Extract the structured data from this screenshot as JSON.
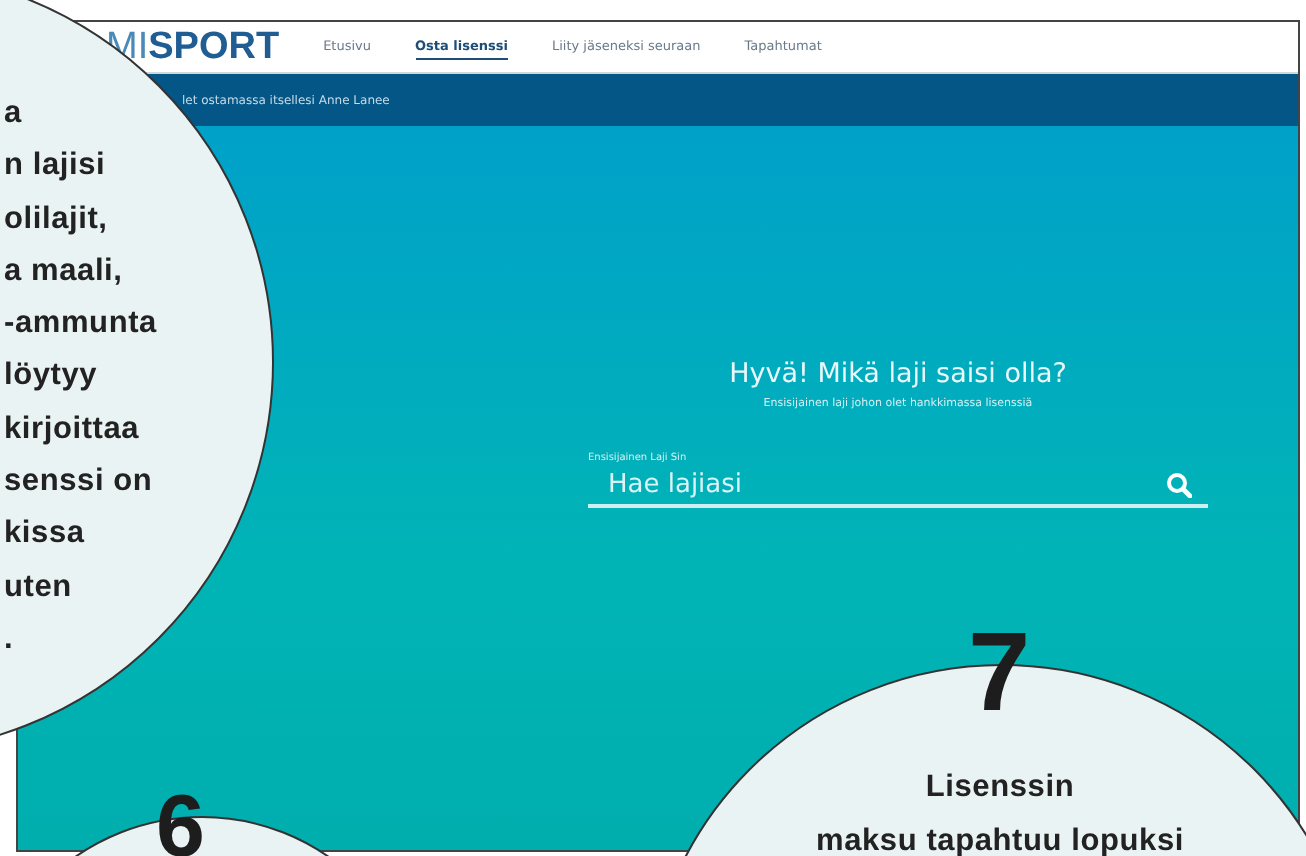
{
  "site": {
    "logo": "MI**SPORT**",
    "nav": [
      {
        "label": "Etusivu",
        "selected": false
      },
      {
        "label": "Osta lisenssi",
        "selected": true
      },
      {
        "label": "Liity jäseneksi seuraan",
        "selected": false
      },
      {
        "label": "Tapahtumat",
        "selected": false
      }
    ],
    "banner": "let ostamassa itsellesi Anne Lanee",
    "heading": "Hyvä! Mikä laji saisi olla?",
    "subheading": "Ensisijainen laji johon olet hankkimassa lisenssiä",
    "search": {
      "label": "Ensisijainen Laji Sin",
      "placeholder": "Hae lajiasi"
    }
  },
  "callouts": [
    {
      "lines": [
        "a",
        "n lajisi",
        "olilajit,",
        "a maali,",
        "-ammunta",
        "löytyy",
        "kirjoittaa",
        "senssi on",
        "kissa",
        "uten",
        "."
      ]
    },
    {
      "number": "6"
    },
    {
      "number": "7",
      "lines": [
        "Lisenssin",
        "maksu tapahtuu lopuksi"
      ]
    }
  ]
}
